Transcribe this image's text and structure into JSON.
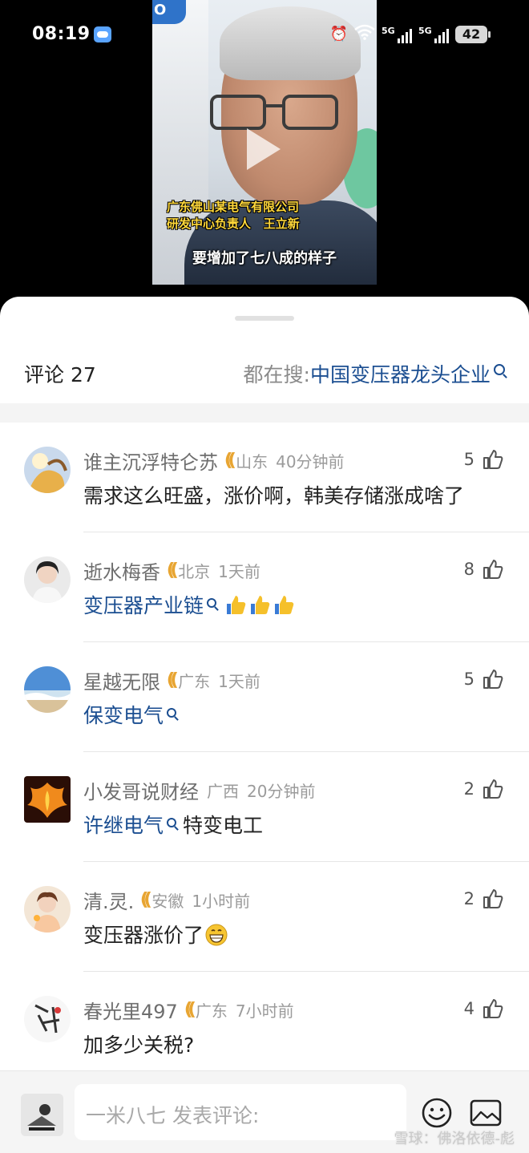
{
  "status_bar": {
    "time": "08:19",
    "network_1": "5G",
    "network_2": "5G",
    "battery": "42"
  },
  "video": {
    "caption_company": "广东佛山某电气有限公司",
    "caption_role": "研发中心负责人",
    "caption_person": "王立新",
    "subtitle": "要增加了七八成的样子"
  },
  "header": {
    "comments_label": "评论 27",
    "search_prefix": "都在搜: ",
    "search_term": "中国变压器龙头企业"
  },
  "comments": [
    {
      "name": "谁主沉浮特仑苏",
      "location": "山东",
      "time": "40分钟前",
      "likes": "5",
      "text": "需求这么旺盛，涨价啊，韩美存储涨成啥了",
      "has_badge": true
    },
    {
      "name": "逝水梅香",
      "location": "北京",
      "time": "1天前",
      "likes": "8",
      "link_text": "变压器产业链",
      "has_badge": true
    },
    {
      "name": "星越无限",
      "location": "广东",
      "time": "1天前",
      "likes": "5",
      "link_text": "保变电气",
      "has_badge": true
    },
    {
      "name": "小发哥说财经",
      "location": "广西",
      "time": "20分钟前",
      "likes": "2",
      "link_text": "许继电气",
      "text_after": " 特变电工",
      "has_badge": false
    },
    {
      "name": "清.灵.",
      "location": "安徽",
      "time": "1小时前",
      "likes": "2",
      "text": "变压器涨价了",
      "has_badge": true
    },
    {
      "name": "春光里497",
      "location": "广东",
      "time": "7小时前",
      "likes": "4",
      "text": "加多少关税?",
      "has_badge": true
    }
  ],
  "bottom_bar": {
    "input_placeholder": "一米八七 发表评论:",
    "watermark": "雪球：佛洛依德-彪"
  },
  "colors": {
    "link_blue": "#1b4e91",
    "badge_gold": "#e8a532",
    "meta_gray": "#9b9b9b"
  },
  "icons": [
    "weather-icon",
    "alarm-icon",
    "wifi-icon",
    "signal-icon",
    "battery-icon",
    "play-icon",
    "search-icon",
    "badge-icon",
    "thumb-up-icon",
    "emoji-icon",
    "image-icon"
  ]
}
